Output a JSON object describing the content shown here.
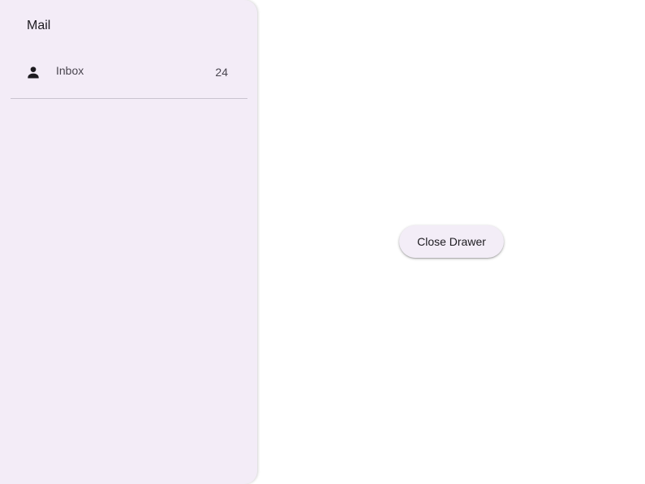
{
  "drawer": {
    "title": "Mail",
    "items": [
      {
        "label": "Inbox",
        "badge": "24",
        "icon": "person-icon"
      }
    ]
  },
  "main": {
    "close_button_label": "Close Drawer"
  },
  "colors": {
    "drawer_background": "#f3ecf7",
    "divider": "#cac4d0",
    "button_background": "#f3edf7"
  }
}
